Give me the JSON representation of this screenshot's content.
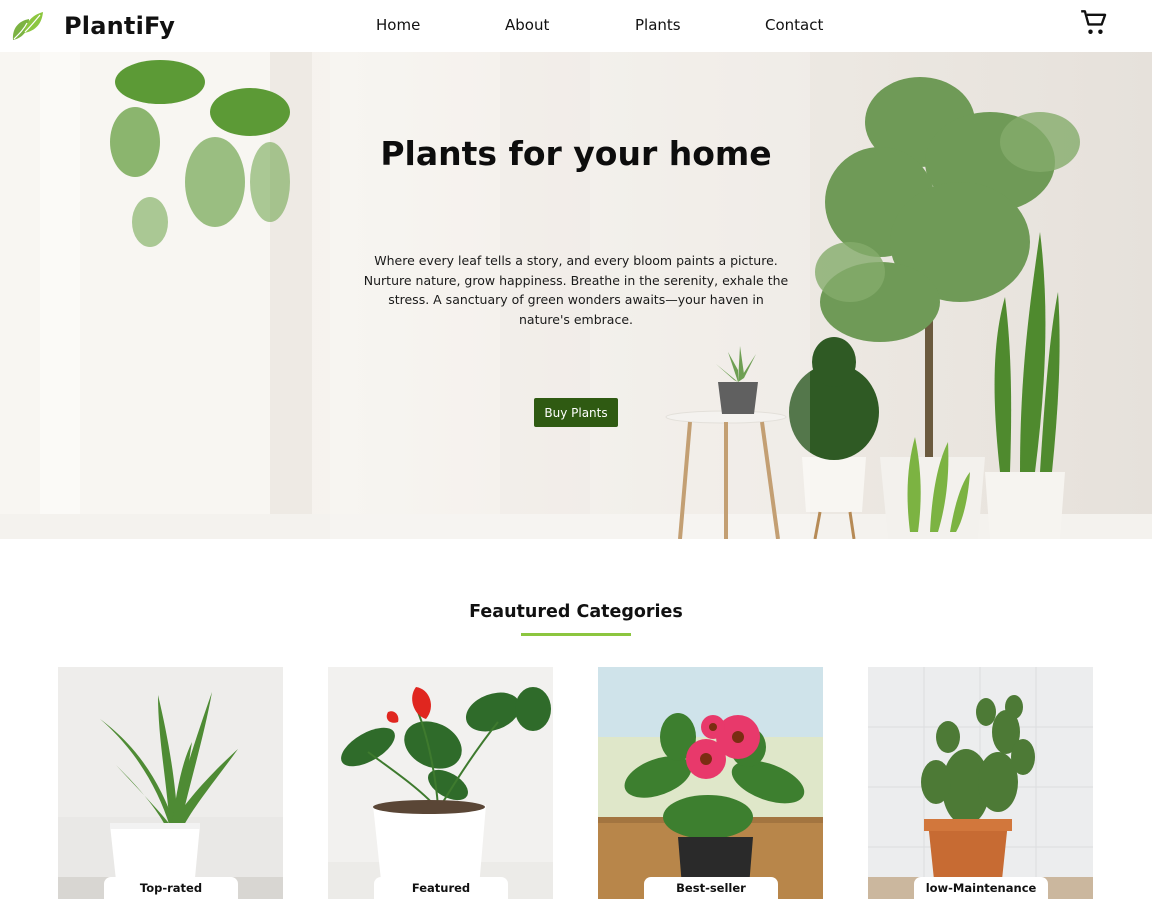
{
  "brand": {
    "name": "PlantiFy",
    "icon": "leaf-icon",
    "accent": "#8cc63f",
    "button_color": "#2f5a12"
  },
  "nav": {
    "items": [
      {
        "label": "Home"
      },
      {
        "label": "About"
      },
      {
        "label": "Plants"
      },
      {
        "label": "Contact"
      }
    ],
    "cart_icon": "cart-icon"
  },
  "hero": {
    "title": "Plants for your home",
    "description": "Where every leaf tells a story, and every bloom paints a picture. Nurture nature, grow happiness. Breathe in the serenity, exhale the stress. A sanctuary of green wonders awaits—your haven in nature's embrace.",
    "button_label": "Buy Plants"
  },
  "featured": {
    "title": "Feautured Categories",
    "categories": [
      {
        "label": "Top-rated"
      },
      {
        "label": "Featured"
      },
      {
        "label": "Best-seller"
      },
      {
        "label": "low-Maintenance"
      }
    ]
  }
}
